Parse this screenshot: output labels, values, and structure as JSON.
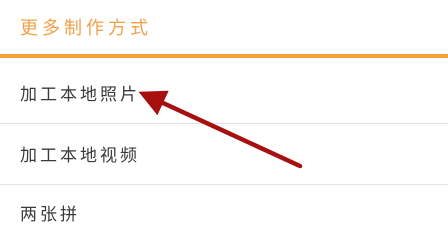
{
  "header": {
    "title": "更多制作方式",
    "accent_color": "#f7a13a"
  },
  "menu": {
    "items": [
      {
        "label": "加工本地照片"
      },
      {
        "label": "加工本地视频"
      },
      {
        "label": "两张拼"
      }
    ]
  },
  "annotation": {
    "icon": "arrow-pointer-icon",
    "color": "#a80f0f"
  }
}
